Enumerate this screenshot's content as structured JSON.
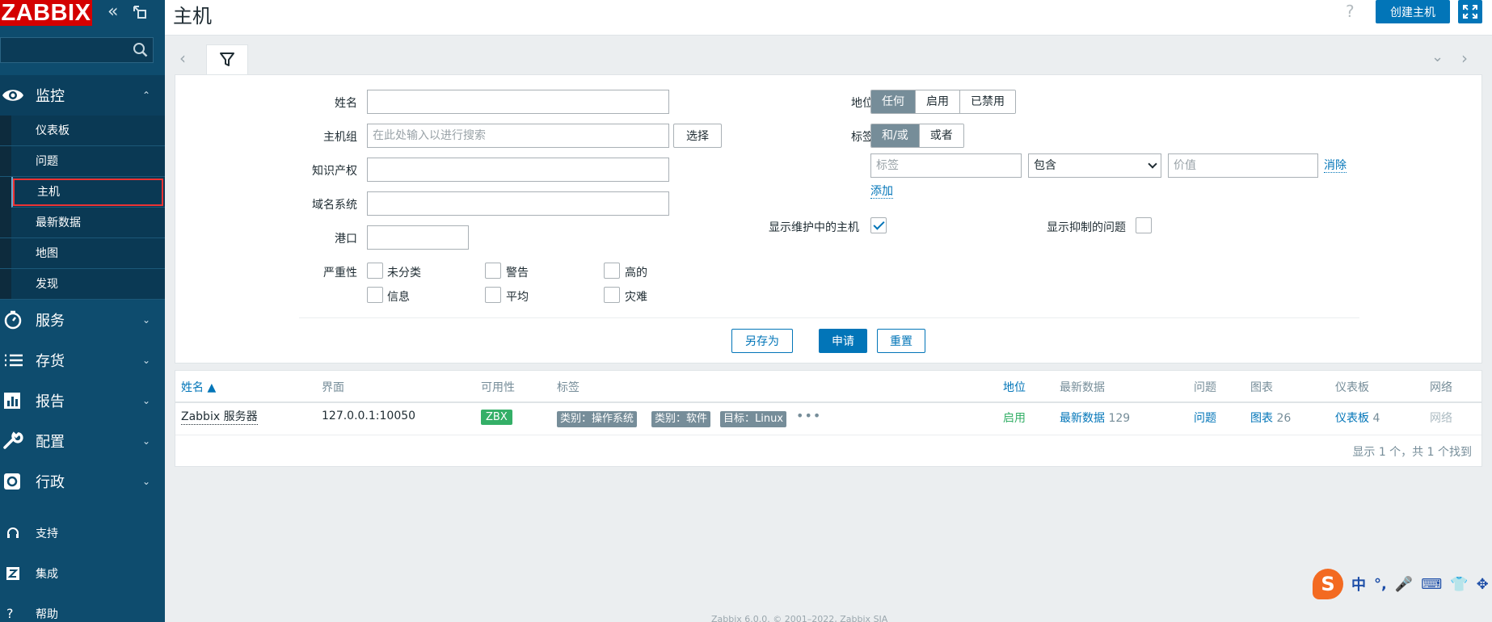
{
  "app": {
    "logo": "ZABBIX",
    "title": "主机",
    "create_host_button": "创建主机",
    "help": "?"
  },
  "sidebar": {
    "search_placeholder": "",
    "monitoring": {
      "label": "监控",
      "items": [
        "仪表板",
        "问题",
        "主机",
        "最新数据",
        "地图",
        "发现"
      ]
    },
    "sections": [
      {
        "label": "服务",
        "icon": "stopwatch-icon"
      },
      {
        "label": "存货",
        "icon": "list-icon"
      },
      {
        "label": "报告",
        "icon": "bar-chart-icon"
      },
      {
        "label": "配置",
        "icon": "wrench-icon"
      },
      {
        "label": "行政",
        "icon": "gear-icon"
      }
    ],
    "bottom": [
      {
        "label": "支持",
        "icon": "headset-icon"
      },
      {
        "label": "集成",
        "icon": "zabbix-z-icon"
      },
      {
        "label": "帮助",
        "icon": "question-icon"
      }
    ]
  },
  "filter": {
    "name_label": "姓名",
    "hostgroup_label": "主机组",
    "hostgroup_placeholder": "在此处输入以进行搜索",
    "select_button": "选择",
    "ip_label": "知识产权",
    "dns_label": "域名系统",
    "port_label": "港口",
    "severity_label": "严重性",
    "severities": [
      "未分类",
      "警告",
      "高的",
      "信息",
      "平均",
      "灾难"
    ],
    "status_label": "地位",
    "status_options": [
      "任何",
      "启用",
      "已禁用"
    ],
    "tags_label": "标签",
    "tags_options": [
      "和/或",
      "或者"
    ],
    "tag_placeholder": "标签",
    "tag_operator": "包含",
    "tag_value_placeholder": "价值",
    "remove_link": "消除",
    "add_link": "添加",
    "show_maintenance_label": "显示维护中的主机",
    "show_maintenance_checked": true,
    "show_suppressed_label": "显示抑制的问题",
    "show_suppressed_checked": false,
    "save_as_button": "另存为",
    "apply_button": "申请",
    "reset_button": "重置"
  },
  "table": {
    "columns": [
      "姓名 ▲",
      "界面",
      "可用性",
      "标签",
      "地位",
      "最新数据",
      "问题",
      "图表",
      "仪表板",
      "网络"
    ],
    "rows": [
      {
        "name": "Zabbix 服务器",
        "interface": "127.0.0.1:10050",
        "availability": "ZBX",
        "tags": [
          "类别：操作系统",
          "类别：软件",
          "目标：Linux"
        ],
        "more": "•••",
        "status": "启用",
        "latest_data": "最新数据",
        "latest_data_count": "129",
        "problems": "问题",
        "graphs": "图表",
        "graphs_count": "26",
        "dashboards": "仪表板",
        "dashboards_count": "4",
        "web": "网络"
      }
    ],
    "footer": "显示 1 个，共 1 个找到"
  },
  "ime": {
    "logo": "S",
    "items": [
      "中",
      "°,",
      "🎤",
      "⌨",
      "👕",
      "✥"
    ]
  },
  "footer": {
    "copyright": "Zabbix 6.0.0. © 2001–2022, Zabbix SIA"
  },
  "colors": {
    "sidebar": "#0e4c6e",
    "accent": "#0275b8",
    "logo": "#d40000",
    "ok": "#34af67",
    "tag": "#768d99"
  }
}
